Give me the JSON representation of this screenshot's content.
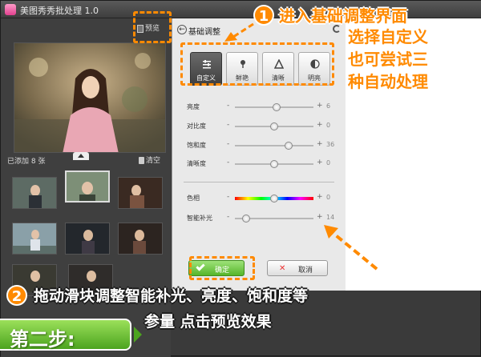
{
  "app": {
    "title": "美图秀秀批处理 1.0"
  },
  "left_panel": {
    "preview_label": "预览",
    "added_count": "已添加 8 张",
    "clear_label": "清空",
    "thumbnail_count": 8
  },
  "adjust_panel": {
    "title": "基础调整",
    "modes": [
      {
        "label": "自定义",
        "icon": "sliders-icon",
        "active": true
      },
      {
        "label": "鲜艳",
        "icon": "flower-icon",
        "active": false
      },
      {
        "label": "清晰",
        "icon": "triangle-icon",
        "active": false
      },
      {
        "label": "明亮",
        "icon": "contrast-icon",
        "active": false
      }
    ],
    "sliders": [
      {
        "label": "亮度",
        "value": "6",
        "level": 0.53
      },
      {
        "label": "对比度",
        "value": "0",
        "level": 0.5
      },
      {
        "label": "饱和度",
        "value": "36",
        "level": 0.68
      },
      {
        "label": "清晰度",
        "value": "0",
        "level": 0.5
      },
      {
        "label": "色相",
        "value": "0",
        "level": 0.5
      },
      {
        "label": "智能补光",
        "value": "14",
        "level": 0.14
      }
    ],
    "minus": "-",
    "plus": "+",
    "confirm_label": "确定",
    "cancel_label": "取消"
  },
  "overlay": {
    "step1_num": "1",
    "step1_lines": [
      "进入基础调整界面",
      "选择自定义",
      "也可尝试三",
      "种自动处理"
    ],
    "step2_num": "2",
    "step2_lines": [
      "拖动滑块调整智能补光、亮度、饱和度等",
      "参量 点击预览效果"
    ],
    "banner": "第二步:",
    "accent": "#ff8a00",
    "banner_color": "#4ca41f"
  }
}
